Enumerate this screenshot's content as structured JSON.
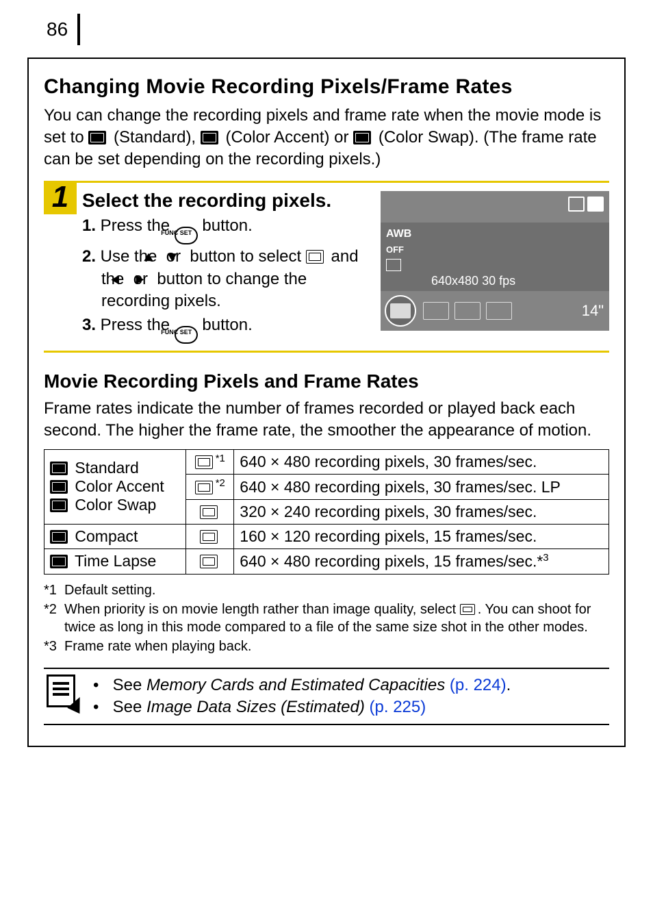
{
  "page_number": "86",
  "section1": {
    "heading": "Changing Movie Recording Pixels/Frame Rates",
    "intro_a": "You can change the recording pixels and frame rate when the movie mode is set to ",
    "setting_standard": " (Standard), ",
    "setting_accent": " (Color Accent) or ",
    "setting_swap": " (Color Swap). (The frame rate can be set depending on the recording pixels.)"
  },
  "step1": {
    "num": "1",
    "title": "Select the recording pixels.",
    "s1_a": "1.",
    "s1_b": " Press the ",
    "s1_c": " button.",
    "s2_a": "2.",
    "s2_b": " Use the ",
    "s2_c": " or ",
    "s2_d": " button to select ",
    "s2_e": " and the ",
    "s2_f": " or ",
    "s2_g": " button to change the recording pixels.",
    "s3_a": "3.",
    "s3_b": " Press the ",
    "s3_c": " button.",
    "func_label": "FUNC\nSET",
    "arrow_up": "⯅",
    "arrow_down": "⯆",
    "arrow_left": "⯇",
    "arrow_right": "⯈"
  },
  "preview": {
    "awb": "AWB",
    "off": "OFF",
    "osd": "640x480 30 fps",
    "time": "14\""
  },
  "section2": {
    "heading": "Movie Recording Pixels and Frame Rates",
    "intro": "Frame rates indicate the number of frames recorded or played back each second. The higher the frame rate, the smoother the appearance of motion."
  },
  "table": {
    "r1_mode": " Standard",
    "r1_sup": "*1",
    "r1_desc": "640 × 480 recording pixels, 30 frames/sec.",
    "r2_mode": " Color Accent",
    "r2_sup": "*2",
    "r2_desc": "640 × 480 recording pixels, 30 frames/sec. LP",
    "r3_mode": " Color Swap",
    "r3_desc": "320 × 240 recording pixels, 30 frames/sec.",
    "r4_mode": " Compact",
    "r4_desc": "160 × 120 recording pixels, 15 frames/sec.",
    "r5_mode": " Time Lapse",
    "r5_desc_a": "640 × 480 recording pixels, 15 frames/sec.*",
    "r5_desc_sup": "3"
  },
  "footnotes": {
    "f1k": "*1",
    "f1t": "Default setting.",
    "f2k": "*2",
    "f2t_a": "When priority is on movie length rather than image quality, select ",
    "f2t_b": ". You can shoot for twice as long in this mode compared to a file of the same size shot in the other modes.",
    "f3k": "*3",
    "f3t": "Frame rate when playing back."
  },
  "notes": {
    "n1_a": "See ",
    "n1_i": "Memory Cards and Estimated Capacities",
    "n1_link": " (p. 224)",
    "n1_dot": ".",
    "n2_a": "See ",
    "n2_i": "Image Data Sizes (Estimated)",
    "n2_link": " (p. 225)"
  }
}
